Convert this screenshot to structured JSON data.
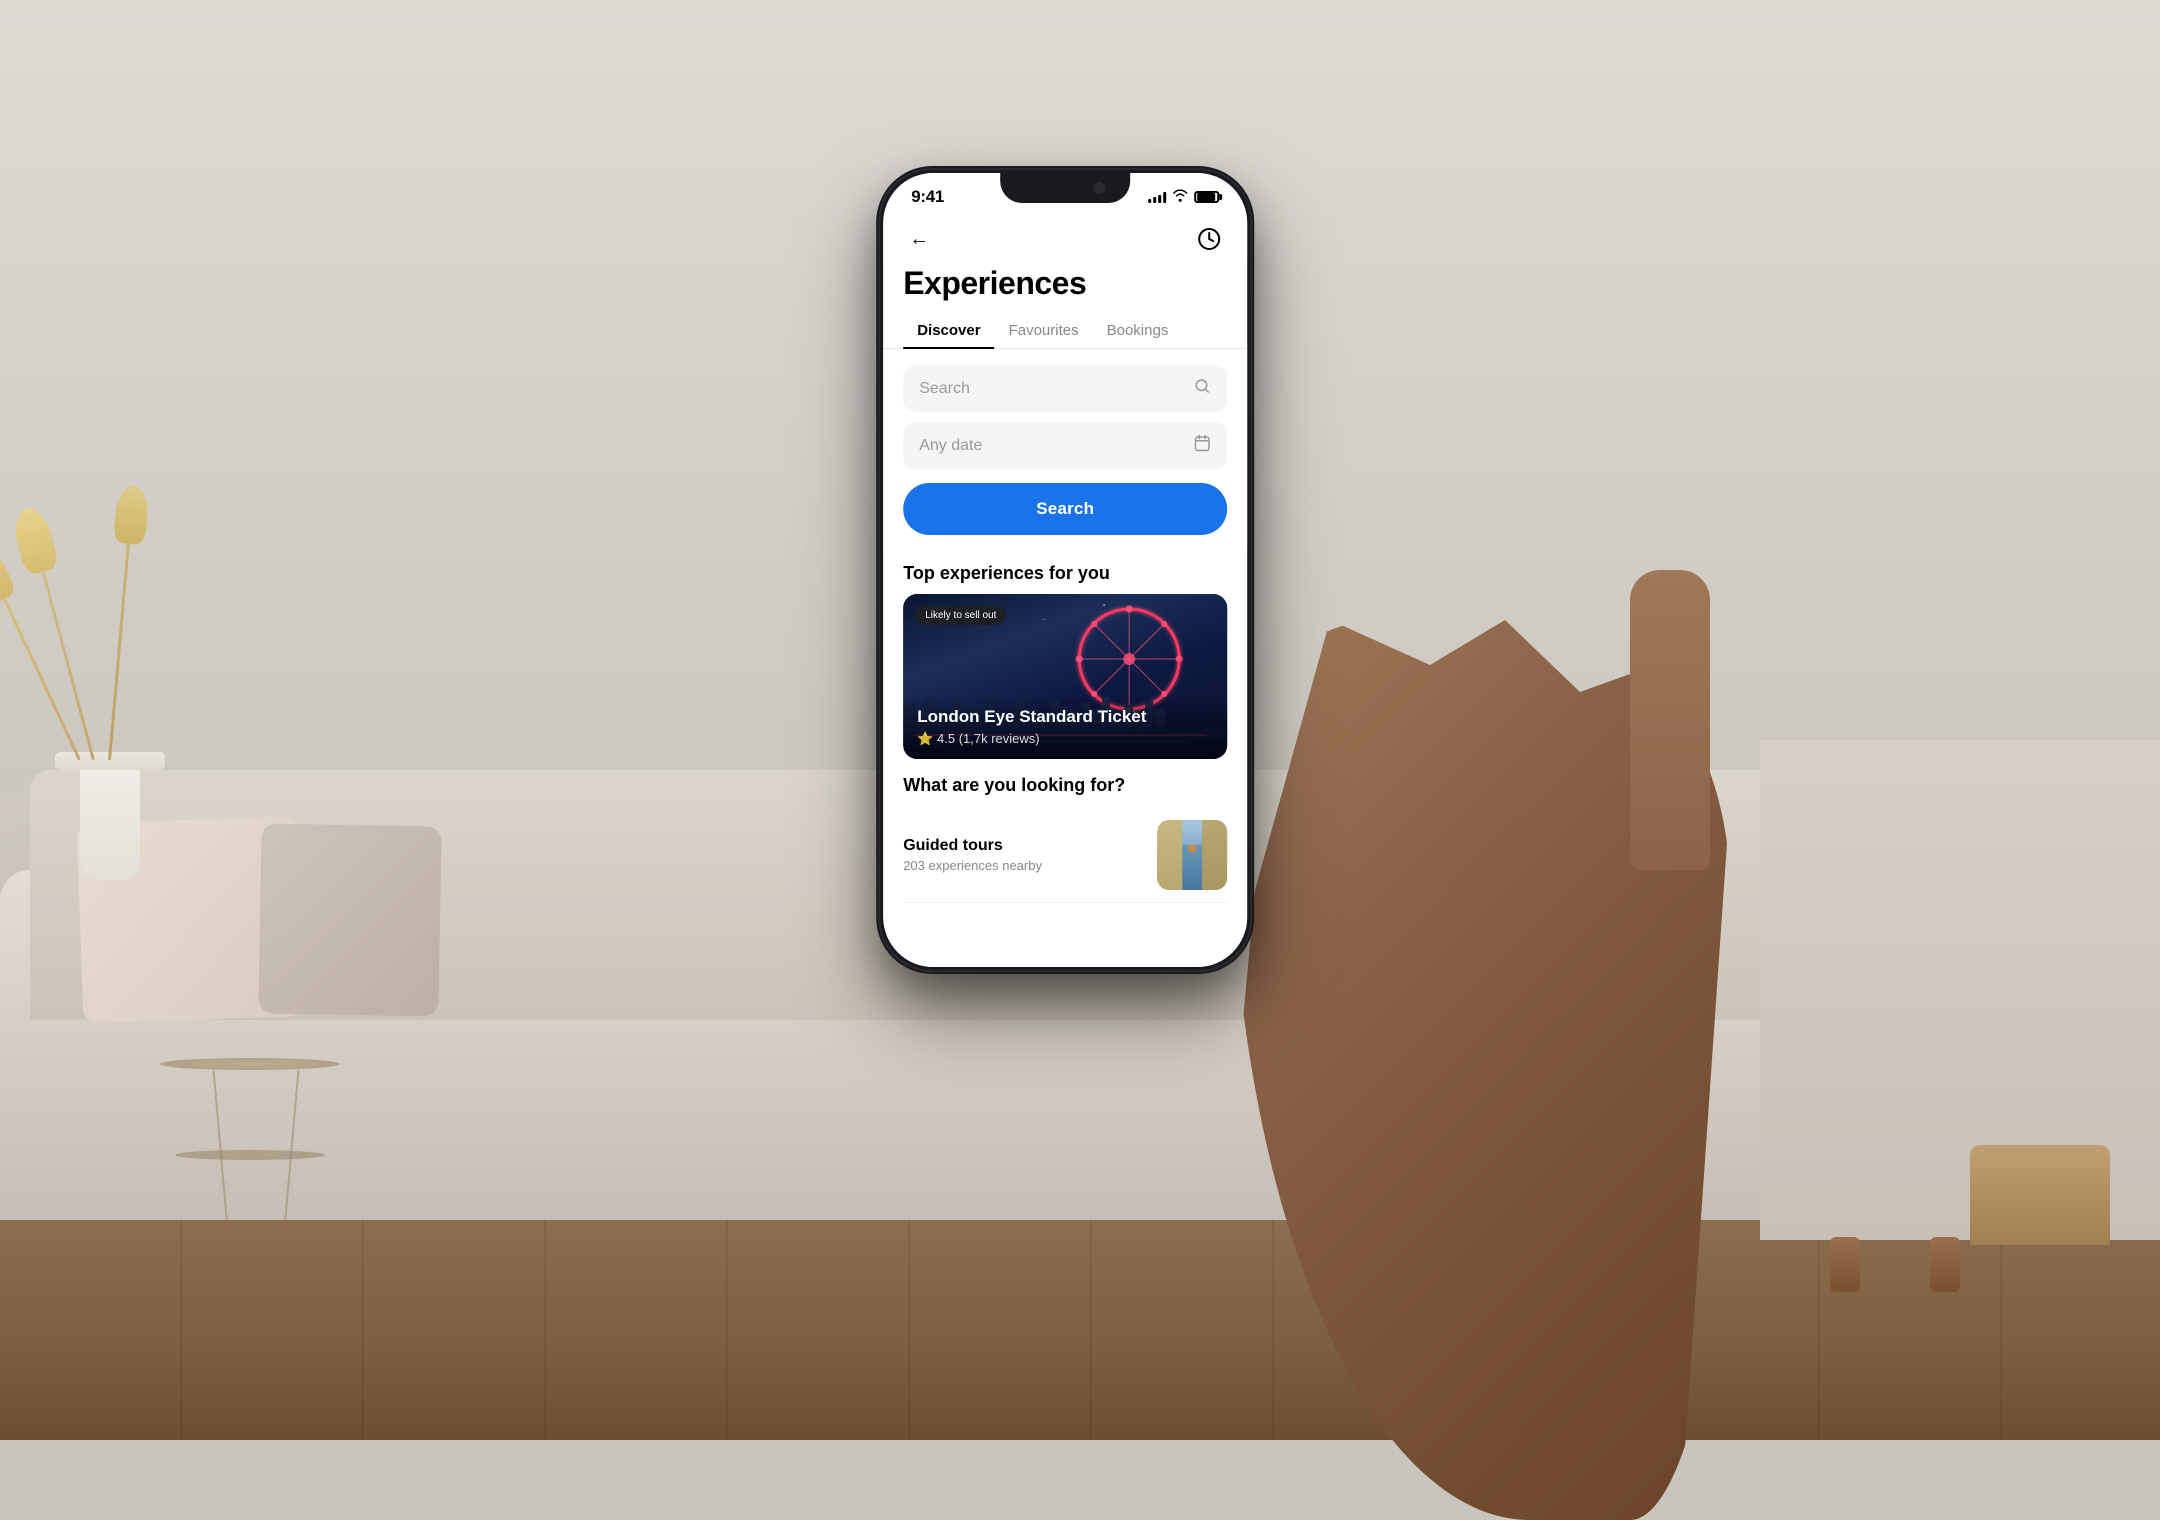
{
  "background": {
    "color": "#c8c5be"
  },
  "phone": {
    "status_bar": {
      "time": "9:41",
      "signal_label": "signal",
      "wifi_label": "wifi",
      "battery_label": "battery"
    },
    "nav": {
      "back_label": "←",
      "icon_label": "©"
    },
    "page": {
      "title": "Experiences"
    },
    "tabs": [
      {
        "label": "Discover",
        "active": true
      },
      {
        "label": "Favourites",
        "active": false
      },
      {
        "label": "Bookings",
        "active": false
      }
    ],
    "search": {
      "input_placeholder": "Search",
      "date_placeholder": "Any date",
      "button_label": "Search"
    },
    "top_experiences": {
      "heading": "Top experiences for you",
      "card": {
        "badge": "Likely to sell out",
        "title": "London Eye Standard Ticket",
        "rating": "4.5 (1,7k reviews)"
      }
    },
    "what_section": {
      "heading": "What are you looking for?",
      "categories": [
        {
          "name": "Guided tours",
          "count": "203 experiences nearby"
        }
      ]
    }
  },
  "colors": {
    "accent_blue": "#1a73e8",
    "text_primary": "#000000",
    "text_secondary": "#888888",
    "tab_active": "#000000",
    "search_bg": "#f5f5f5",
    "card_bg": "#1a2a4a",
    "badge_bg": "rgba(30,30,30,0.85)"
  }
}
